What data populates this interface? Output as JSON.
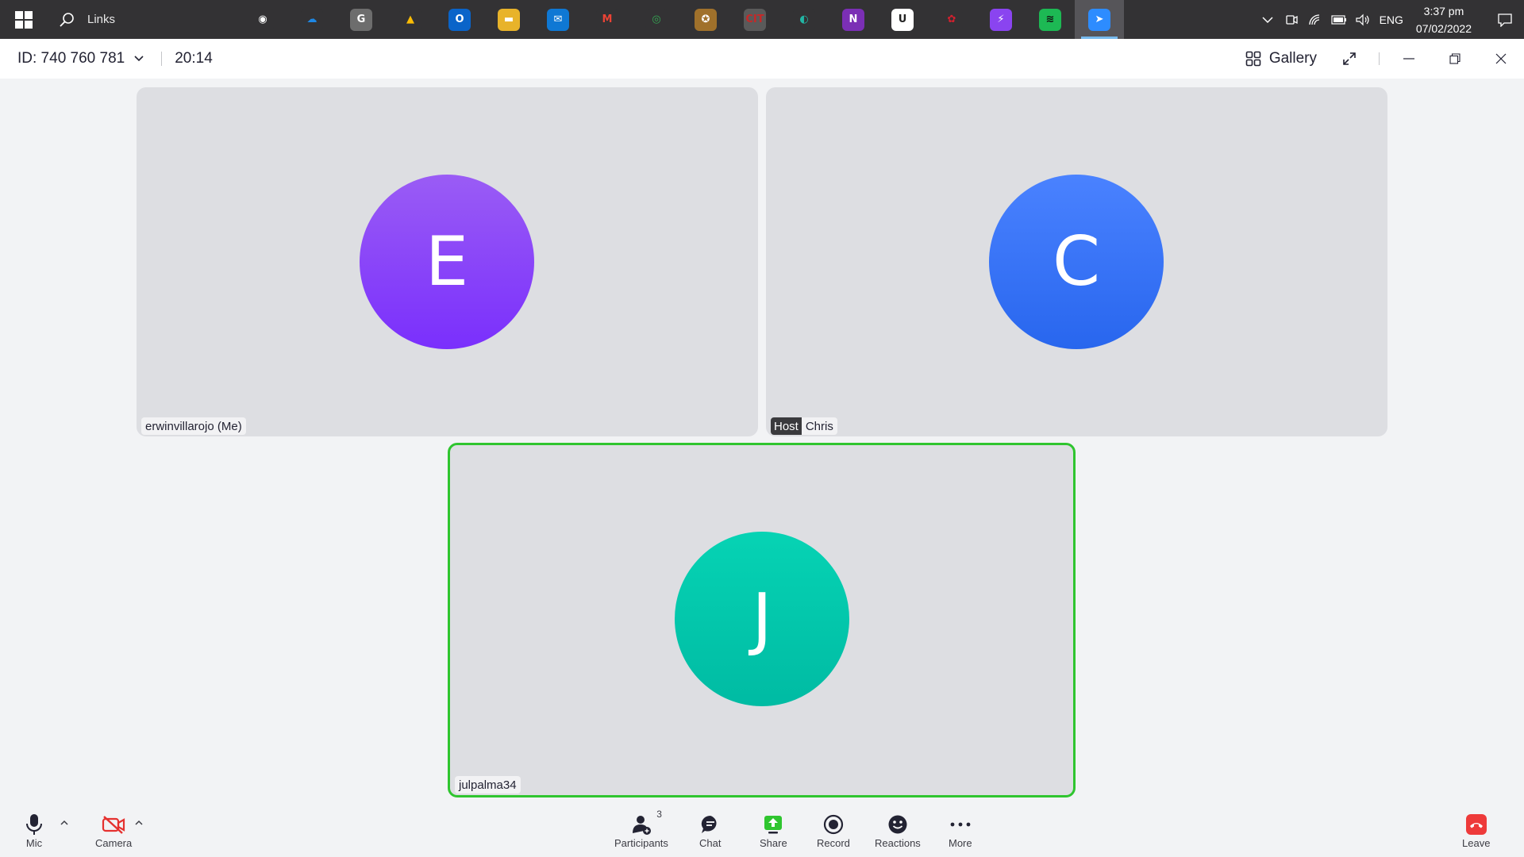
{
  "taskbar": {
    "search_text": "Links",
    "apps": [
      {
        "name": "obs-icon",
        "bg": "#333234",
        "fg": "#ffffff",
        "glyph": "◉"
      },
      {
        "name": "onedrive-icon",
        "bg": "#333234",
        "fg": "#1e88e5",
        "glyph": "☁"
      },
      {
        "name": "app-g-icon",
        "bg": "#6d6d6d",
        "fg": "#ffffff",
        "glyph": "G"
      },
      {
        "name": "google-drive-icon",
        "bg": "#333234",
        "fg": "#fbbc04",
        "glyph": "▲"
      },
      {
        "name": "outlook-icon",
        "bg": "#0a64c9",
        "fg": "#ffffff",
        "glyph": "O"
      },
      {
        "name": "file-explorer-icon",
        "bg": "#e8b32a",
        "fg": "#ffffff",
        "glyph": "▬"
      },
      {
        "name": "mail-icon",
        "bg": "#0f78d4",
        "fg": "#ffffff",
        "glyph": "✉"
      },
      {
        "name": "gmail-icon",
        "bg": "#333234",
        "fg": "#ea4335",
        "glyph": "M"
      },
      {
        "name": "chrome-icon",
        "bg": "#333234",
        "fg": "#34a853",
        "glyph": "◎"
      },
      {
        "name": "badge-app-icon",
        "bg": "#a0712b",
        "fg": "#ffffff",
        "glyph": "✪"
      },
      {
        "name": "cit-icon",
        "bg": "#5a5a5a",
        "fg": "#c62828",
        "glyph": "CIT"
      },
      {
        "name": "edge-icon",
        "bg": "#333234",
        "fg": "#22b5a4",
        "glyph": "◐"
      },
      {
        "name": "onenote-icon",
        "bg": "#7b2fb5",
        "fg": "#ffffff",
        "glyph": "N"
      },
      {
        "name": "udemy-icon",
        "bg": "#ffffff",
        "fg": "#222222",
        "glyph": "U"
      },
      {
        "name": "huawei-icon",
        "bg": "#333234",
        "fg": "#d3202e",
        "glyph": "✿"
      },
      {
        "name": "messenger-icon",
        "bg": "#8a44f0",
        "fg": "#ffffff",
        "glyph": "⚡"
      },
      {
        "name": "spotify-icon",
        "bg": "#1db954",
        "fg": "#111111",
        "glyph": "≋"
      },
      {
        "name": "zoom-app-icon",
        "bg": "#2d8cff",
        "fg": "#ffffff",
        "glyph": "➤"
      }
    ],
    "language": "ENG",
    "time": "3:37 pm",
    "date": "07/02/2022"
  },
  "titlebar": {
    "meeting_id": "ID: 740 760 781",
    "timer": "20:14",
    "view_label": "Gallery"
  },
  "tiles": [
    {
      "initial": "E",
      "name": "erwinvillarojo  (Me)",
      "color_top": "#9a5cf5",
      "color_bottom": "#7a2ffc",
      "host": false,
      "speaking": false
    },
    {
      "initial": "C",
      "name": "Chris",
      "host_label": "Host",
      "color_top": "#4a82ff",
      "color_bottom": "#2866ee",
      "host": true,
      "speaking": false
    },
    {
      "initial": "J",
      "name": "julpalma34",
      "color_top": "#06d3b4",
      "color_bottom": "#00bba3",
      "host": false,
      "speaking": true
    }
  ],
  "toolbar": {
    "mic_label": "Mic",
    "camera_label": "Camera",
    "participants_label": "Participants",
    "participants_count": "3",
    "chat_label": "Chat",
    "share_label": "Share",
    "record_label": "Record",
    "reactions_label": "Reactions",
    "more_label": "More",
    "leave_label": "Leave",
    "share_color": "#2fc52f",
    "leave_color": "#ee3a3a",
    "camera_off_color": "#e5312f"
  }
}
